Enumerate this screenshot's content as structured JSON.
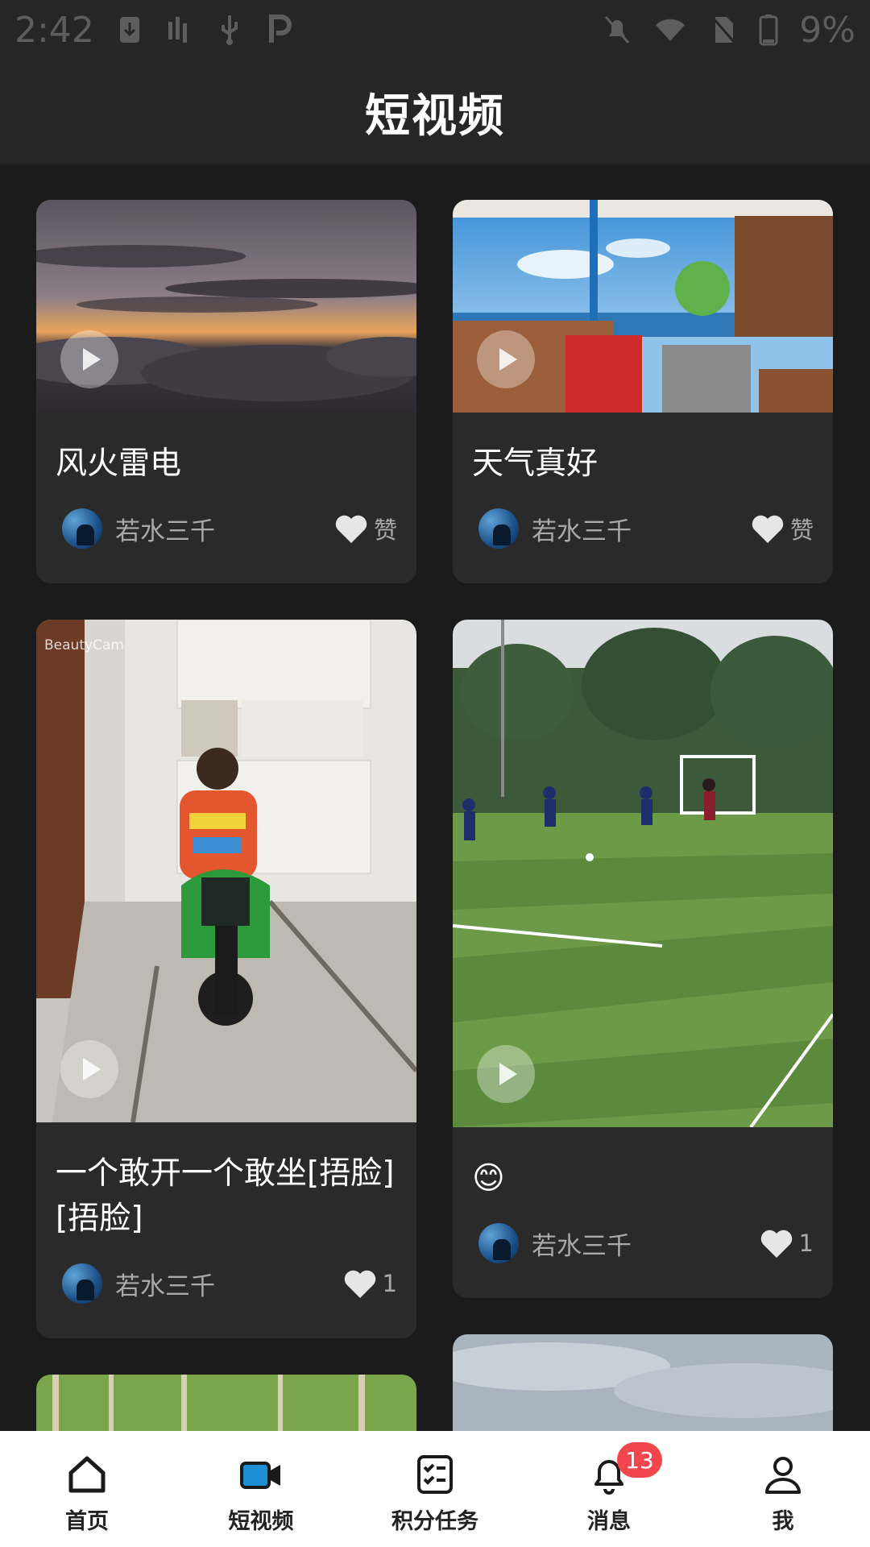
{
  "status_bar": {
    "time": "2:42",
    "battery": "9%",
    "left_icons": [
      "download-icon",
      "sound-bars-icon",
      "usb-icon",
      "parking-icon"
    ],
    "right_icons": [
      "bell-off-icon",
      "wifi-icon",
      "sim-off-icon",
      "battery-icon"
    ]
  },
  "header": {
    "title": "短视频"
  },
  "feed": {
    "left": [
      {
        "title": "风火雷电",
        "author": "若水三千",
        "likes": "赞"
      },
      {
        "title": "一个敢开一个敢坐[捂脸][捂脸]",
        "author": "若水三千",
        "likes": "1",
        "watermark": "BeautyCam"
      }
    ],
    "right": [
      {
        "title": "天气真好",
        "author": "若水三千",
        "likes": "赞"
      },
      {
        "title": "😊",
        "author": "若水三千",
        "likes": "1"
      }
    ]
  },
  "bottom_nav": {
    "items": [
      {
        "label": "首页",
        "icon": "home-icon"
      },
      {
        "label": "短视频",
        "icon": "video-camera-icon"
      },
      {
        "label": "积分任务",
        "icon": "task-list-icon"
      },
      {
        "label": "消息",
        "icon": "bell-icon",
        "badge": "13"
      },
      {
        "label": "我",
        "icon": "user-icon"
      }
    ]
  },
  "colors": {
    "background": "#1b1b1b",
    "card": "#2a2a2a",
    "header": "#262626",
    "accent_blue": "#1e8fd6",
    "badge_red": "#f1464d"
  }
}
